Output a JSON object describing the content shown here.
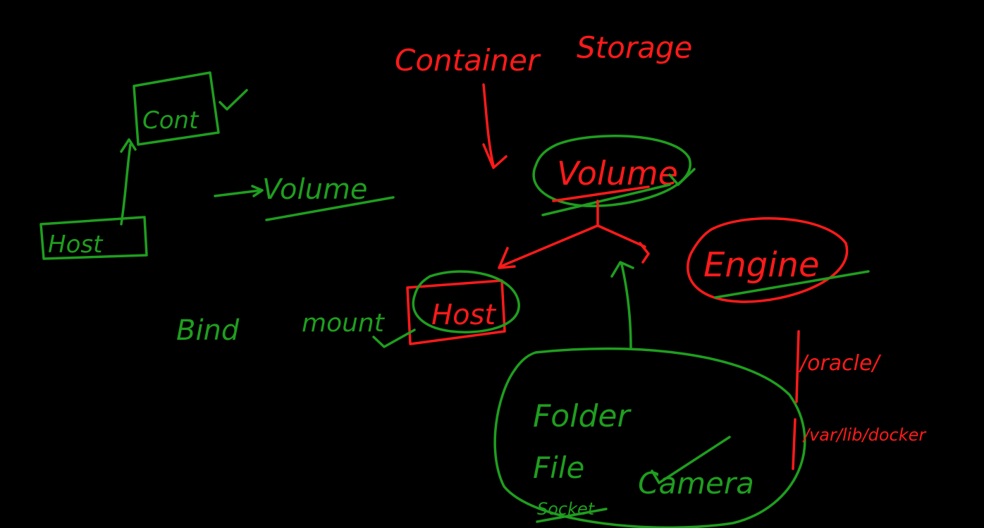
{
  "colors": {
    "background": "#000000",
    "green": "#1f9e1f",
    "red": "#ff1a1a"
  },
  "labels": {
    "title_container": "Container",
    "title_storage": "Storage",
    "volume_center": "Volume",
    "volume_left": "Volume",
    "engine": "Engine",
    "cont": "Cont",
    "host_left": "Host",
    "host_center": "Host",
    "bind": "Bind",
    "mount": "mount",
    "folder": "Folder",
    "file": "File",
    "socket": "Socket",
    "camera": "Camera",
    "path_oracle": "/oracle/",
    "path_docker": "/var/lib/docker"
  }
}
